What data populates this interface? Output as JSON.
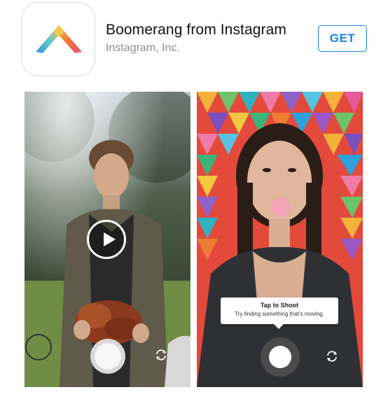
{
  "app": {
    "name": "Boomerang from Instagram",
    "developer": "Instagram, Inc.",
    "get_label": "GET",
    "icon": "boomerang-chevron-icon"
  },
  "colors": {
    "accent": "#1a80e6",
    "icon_gradient": [
      "#f7b733",
      "#ef6b2b",
      "#e3497f",
      "#2e8be0",
      "#55c7c9"
    ]
  },
  "screenshots": [
    {
      "description_icon": "play-icon",
      "controls": {
        "shutter": "shutter-button",
        "flip": "camera-flip-icon"
      }
    },
    {
      "tooltip": {
        "title": "Tap to Shoot",
        "body": "Try finding something that’s moving."
      },
      "controls": {
        "shutter": "shutter-button",
        "flip": "camera-flip-icon"
      }
    }
  ]
}
